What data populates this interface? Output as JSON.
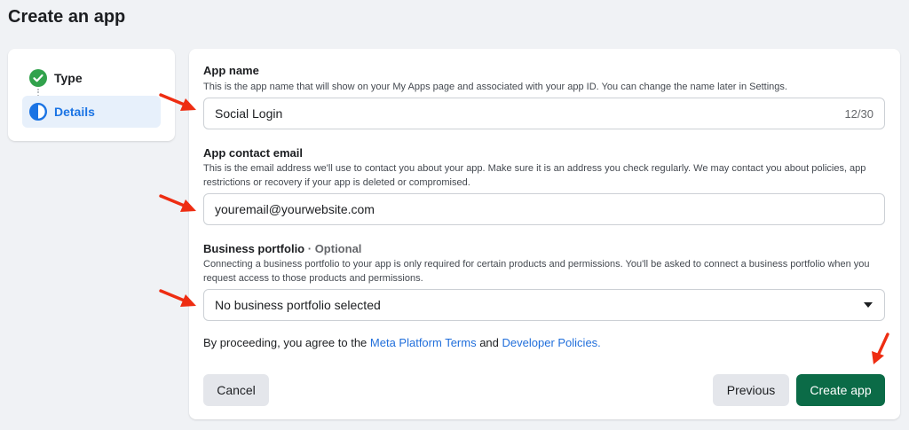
{
  "page": {
    "title": "Create an app"
  },
  "stepper": {
    "steps": [
      {
        "label": "Type",
        "status": "complete",
        "icon": "check-circle-icon"
      },
      {
        "label": "Details",
        "status": "current",
        "icon": "half-circle-icon"
      }
    ]
  },
  "form": {
    "app_name": {
      "label": "App name",
      "description": "This is the app name that will show on your My Apps page and associated with your app ID. You can change the name later in Settings.",
      "value": "Social Login",
      "counter": "12/30"
    },
    "contact_email": {
      "label": "App contact email",
      "description": "This is the email address we'll use to contact you about your app. Make sure it is an address you check regularly. We may contact you about policies, app restrictions or recovery if your app is deleted or compromised.",
      "value": "youremail@yourwebsite.com"
    },
    "business_portfolio": {
      "label": "Business portfolio",
      "optional_tag": "· Optional",
      "description": "Connecting a business portfolio to your app is only required for certain products and permissions. You'll be asked to connect a business portfolio when you request access to those products and permissions.",
      "selected": "No business portfolio selected"
    },
    "terms": {
      "prefix": "By proceeding, you agree to the ",
      "link1": "Meta Platform Terms",
      "middle": " and ",
      "link2": "Developer Policies."
    }
  },
  "buttons": {
    "cancel": "Cancel",
    "previous": "Previous",
    "create": "Create app"
  },
  "colors": {
    "accent_blue": "#1b74e4",
    "success_green": "#31a24c",
    "primary_button": "#0b6b47",
    "annotation_arrow": "#ee2d12"
  }
}
